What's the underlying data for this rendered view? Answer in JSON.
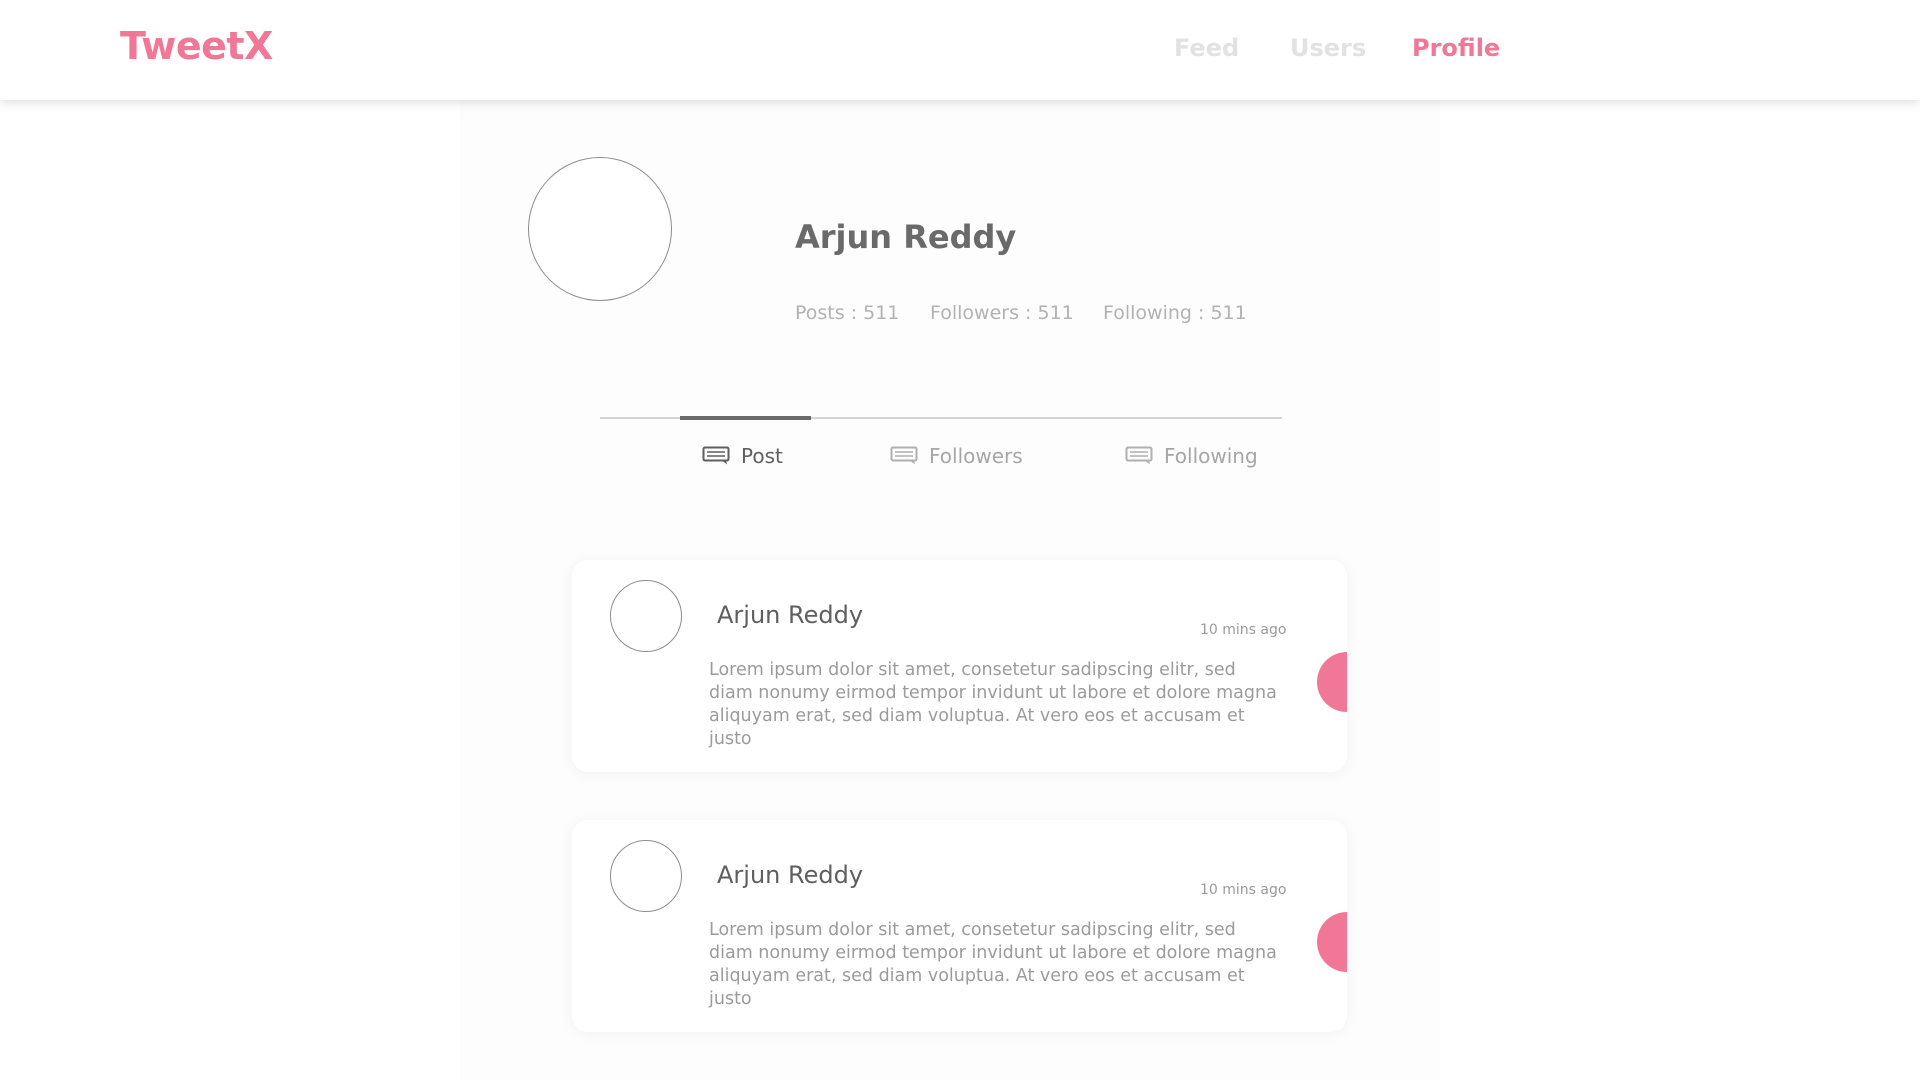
{
  "brand": {
    "name": "TweetX",
    "color": "#f07896"
  },
  "nav": {
    "items": [
      {
        "label": "Feed",
        "active": false
      },
      {
        "label": "Users",
        "active": false
      },
      {
        "label": "Profile",
        "active": true
      }
    ]
  },
  "profile": {
    "name": "Arjun Reddy",
    "stats": [
      {
        "label": "Posts",
        "value": "511",
        "display": "Posts : 511"
      },
      {
        "label": "Followers",
        "value": "511",
        "display": "Followers : 511"
      },
      {
        "label": "Following",
        "value": "511",
        "display": "Following : 511"
      }
    ]
  },
  "tabs": [
    {
      "label": "Post",
      "icon": "message-icon",
      "active": true
    },
    {
      "label": "Followers",
      "icon": "message-icon",
      "active": false
    },
    {
      "label": "Following",
      "icon": "message-icon",
      "active": false
    }
  ],
  "posts": [
    {
      "author": "Arjun Reddy",
      "time": "10 mins ago",
      "body": "Lorem ipsum dolor sit amet, consetetur sadipscing elitr, sed diam nonumy eirmod tempor invidunt ut labore et dolore magna aliquyam erat, sed diam voluptua. At vero eos et accusam et justo"
    },
    {
      "author": "Arjun Reddy",
      "time": "10 mins ago",
      "body": "Lorem ipsum dolor sit amet, consetetur sadipscing elitr, sed diam nonumy eirmod tempor invidunt ut labore et dolore magna aliquyam erat, sed diam voluptua. At vero eos et accusam et justo"
    }
  ],
  "colors": {
    "accent": "#f07896",
    "inactive_nav": "#e2e2e2",
    "text_dark": "#6a6a6a",
    "text_muted": "#b2b2b2"
  }
}
